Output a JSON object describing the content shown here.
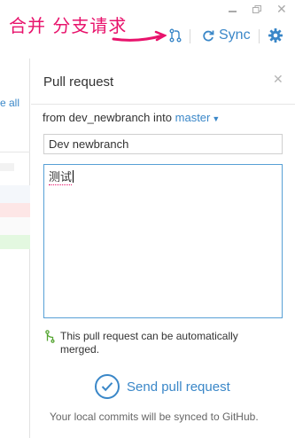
{
  "annotation": {
    "text": "合并 分支请求"
  },
  "toolbar": {
    "sync_label": "Sync",
    "icons": [
      "pull-request-icon",
      "sync-icon",
      "gear-icon"
    ]
  },
  "window": {
    "icons": [
      "minimize-icon",
      "maximize-icon",
      "close-icon"
    ]
  },
  "left": {
    "see_all": "e all"
  },
  "panel": {
    "title": "Pull request",
    "from_prefix": "from",
    "source_branch": "dev_newbranch",
    "into_label": "into",
    "target_branch": "master",
    "title_value": "Dev newbranch",
    "body_value": "测试",
    "merge_status": "This pull request can be automatically merged.",
    "send_label": "Send pull request",
    "footer_note": "Your local commits will be synced to GitHub."
  },
  "colors": {
    "accent": "#3a87c8",
    "annotation": "#e8136c",
    "merge_green": "#55a532"
  }
}
